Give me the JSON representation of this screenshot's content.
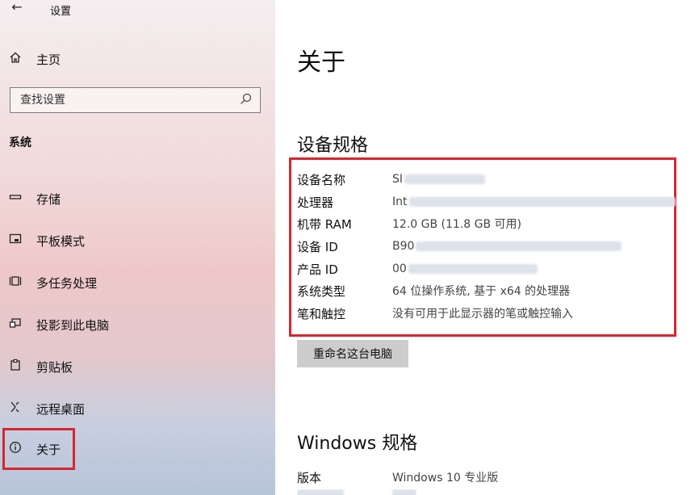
{
  "window": {
    "title": "设置"
  },
  "sidebar": {
    "home_label": "主页",
    "search_placeholder": "查找设置",
    "section_heading": "系统",
    "items": [
      {
        "label": "存储",
        "icon": "storage-icon"
      },
      {
        "label": "平板模式",
        "icon": "tablet-mode-icon"
      },
      {
        "label": "多任务处理",
        "icon": "multitasking-icon"
      },
      {
        "label": "投影到此电脑",
        "icon": "projecting-icon"
      },
      {
        "label": "剪贴板",
        "icon": "clipboard-icon"
      },
      {
        "label": "远程桌面",
        "icon": "remote-desktop-icon"
      },
      {
        "label": "关于",
        "icon": "info-icon"
      }
    ]
  },
  "main": {
    "title": "关于",
    "spec_section_title": "设备规格",
    "specs": [
      {
        "label": "设备名称",
        "value": "SI"
      },
      {
        "label": "处理器",
        "value": "Int"
      },
      {
        "label": "机带 RAM",
        "value": "12.0 GB (11.8 GB 可用)"
      },
      {
        "label": "设备 ID",
        "value": "B90"
      },
      {
        "label": "产品 ID",
        "value": "00"
      },
      {
        "label": "系统类型",
        "value": "64 位操作系统, 基于 x64 的处理器"
      },
      {
        "label": "笔和触控",
        "value": "没有可用于此显示器的笔或触控输入"
      }
    ],
    "rename_button": "重命名这台电脑",
    "windows_section_title": "Windows 规格",
    "windows_specs": [
      {
        "label": "版本",
        "value": "Windows 10 专业版"
      }
    ]
  },
  "colors": {
    "highlight": "#d7262e",
    "button_bg": "#cccccc"
  }
}
